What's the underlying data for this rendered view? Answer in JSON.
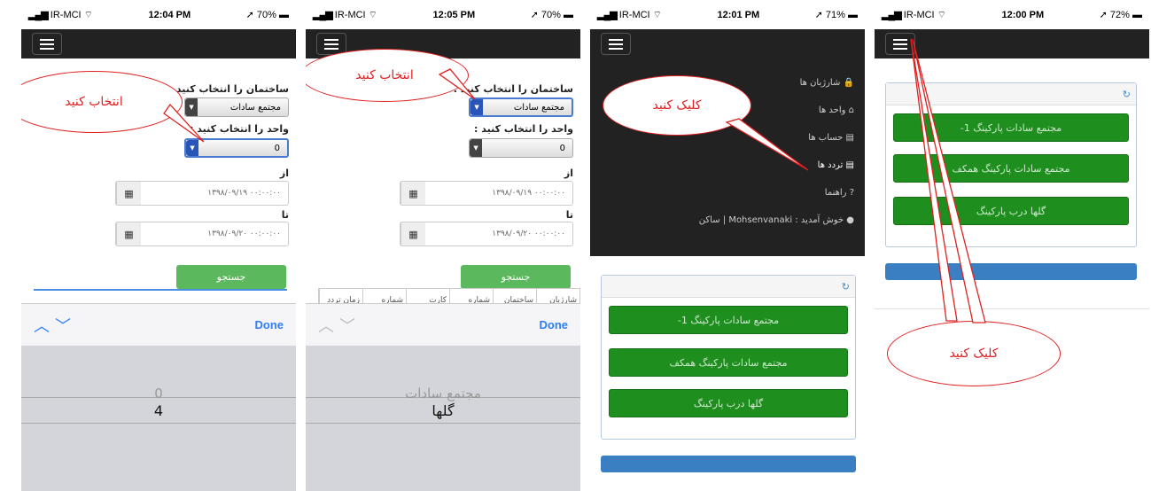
{
  "status_bars": [
    {
      "carrier": "IR-MCI",
      "time": "12:04 PM",
      "battery": "70%"
    },
    {
      "carrier": "IR-MCI",
      "time": "12:05 PM",
      "battery": "70%"
    },
    {
      "carrier": "IR-MCI",
      "time": "12:01 PM",
      "battery": "71%"
    },
    {
      "carrier": "IR-MCI",
      "time": "12:00 PM",
      "battery": "72%"
    }
  ],
  "form": {
    "building_label": "ساختمان را انتخاب کنید :",
    "building_value": "مجتمع سادات",
    "unit_label": "واحد را انتخاب کنید :",
    "unit_value": "0",
    "from_label": "از",
    "from_value": "۰۰:۰۰:۰۰ ۱۳۹۸/۰۹/۱۹",
    "to_label": "تا",
    "to_value": "۰۰:۰۰:۰۰ ۱۳۹۸/۰۹/۲۰",
    "search_label": "جستجو"
  },
  "table_headers": [
    "شارژبان",
    "ساختمان",
    "شماره",
    "کارت",
    "شماره",
    "زمان تردد"
  ],
  "picker": {
    "done_label": "Done",
    "screen1_options": [
      "0",
      "4"
    ],
    "screen2_options": [
      "مجتمع سادات",
      "گلها"
    ]
  },
  "menu": {
    "items": [
      "شارژبان ها",
      "واحد ها",
      "حساب ها",
      "تردد ها",
      "راهنما",
      "خوش آمدید : Mohsenvanaki | ساکن"
    ]
  },
  "parking_buttons": [
    "مجتمع سادات پارکینگ 1-",
    "مجتمع سادات پارکینگ همکف",
    "گلها درب پارکینگ"
  ],
  "callouts": {
    "select": "انتخاب کنید",
    "click": "کلیک کنید"
  }
}
